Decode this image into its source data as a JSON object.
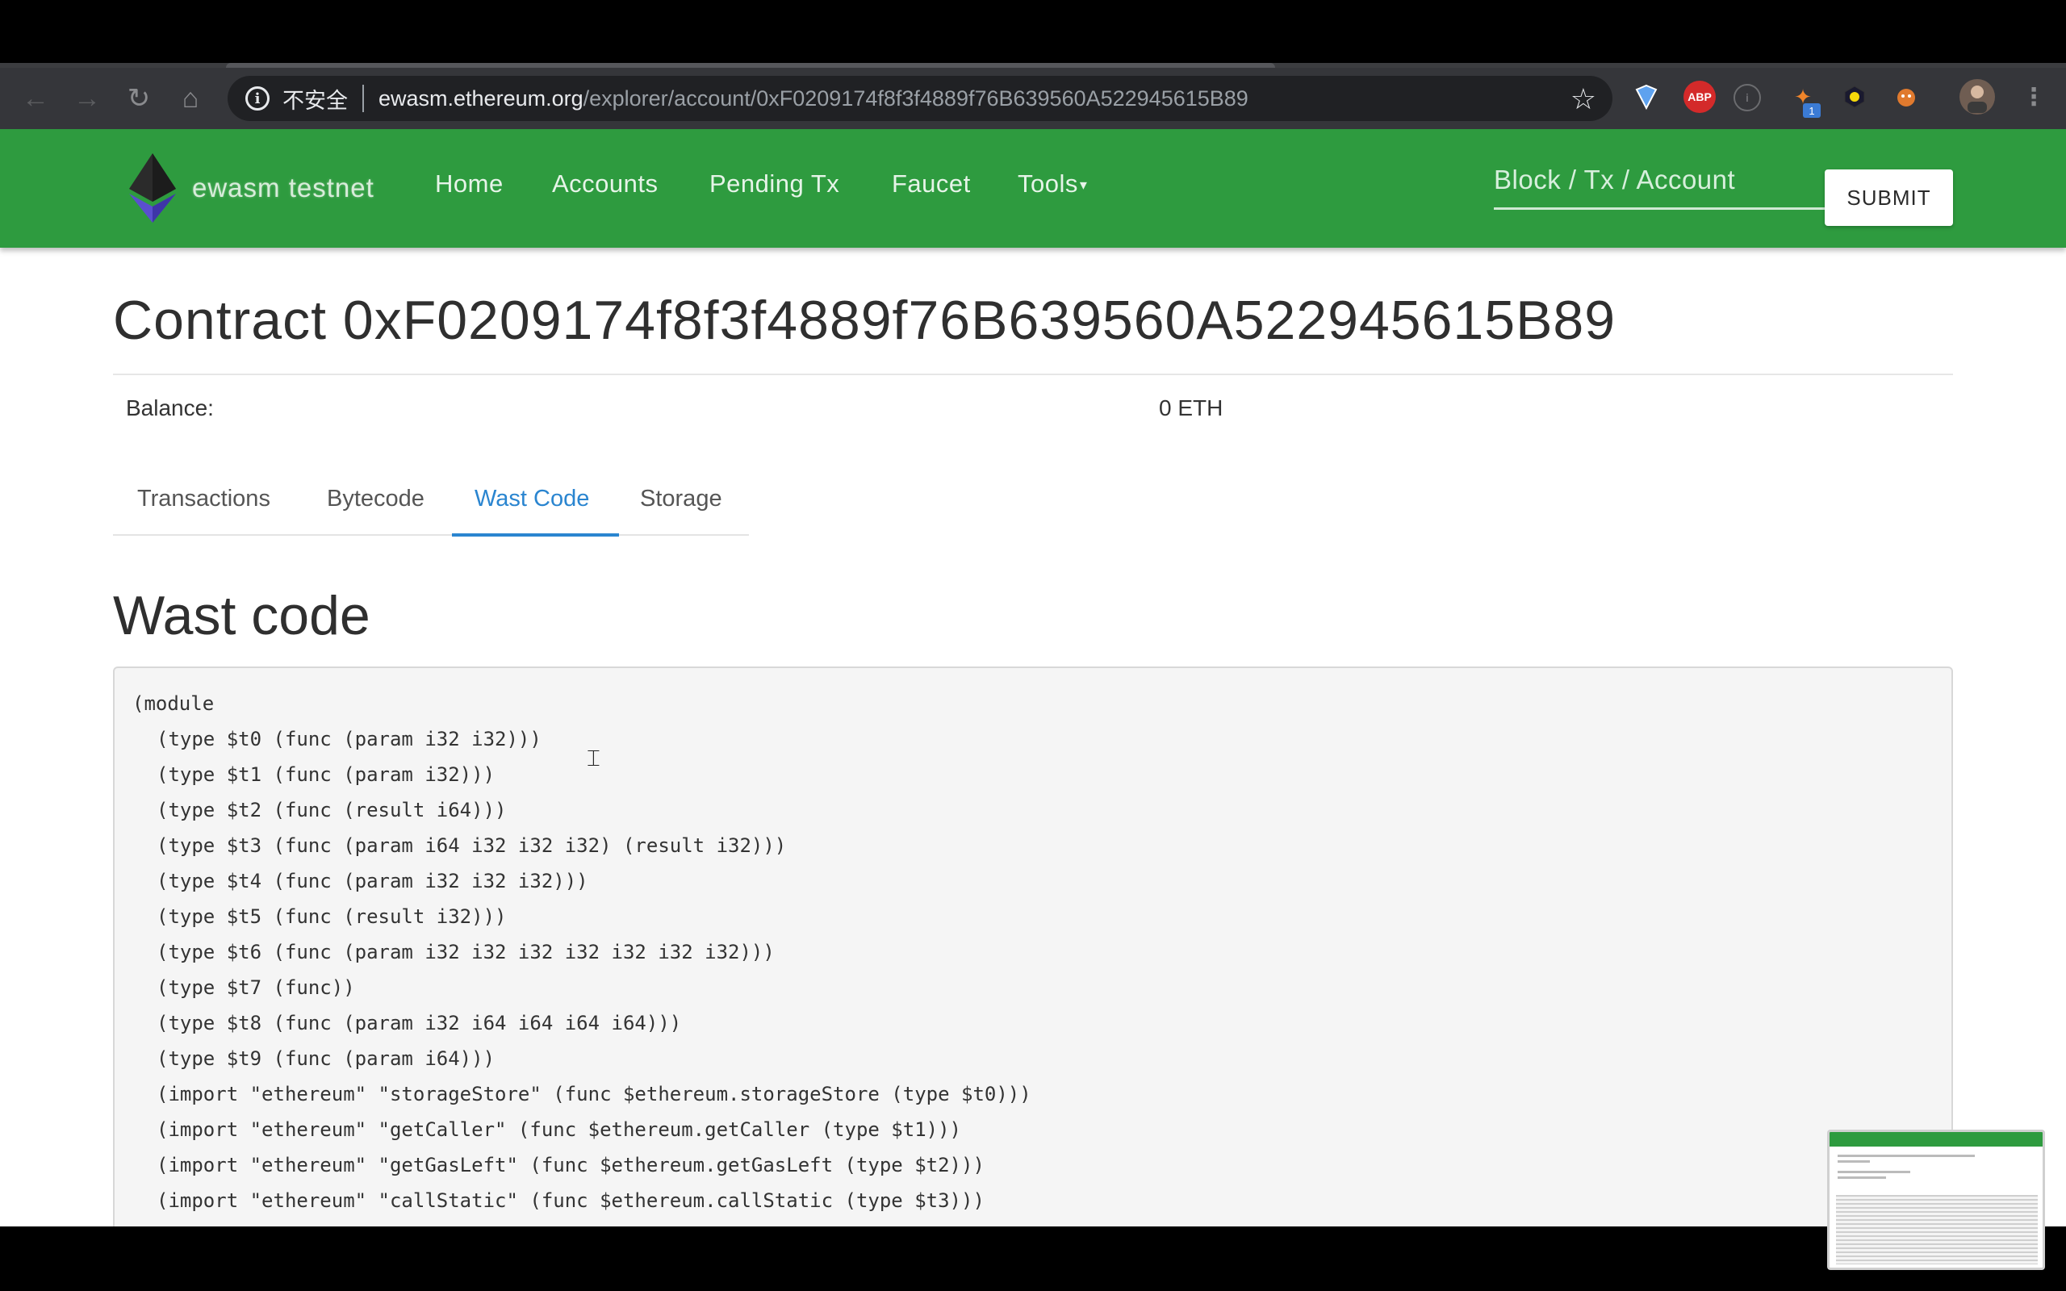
{
  "browser": {
    "security_label": "不安全",
    "url_host": "ewasm.ethereum.org",
    "url_path": "/explorer/account/0xF0209174f8f3f4889f76B639560A522945615B89",
    "extensions": [
      {
        "name": "ABP",
        "color": "#d42a2a"
      },
      {
        "name": "1",
        "color": "#3b7bd4"
      }
    ]
  },
  "site": {
    "brand": "ewasm testnet",
    "nav": [
      "Home",
      "Accounts",
      "Pending Tx",
      "Faucet",
      "Tools"
    ],
    "search_placeholder": "Block / Tx / Account",
    "submit_label": "SUBMIT"
  },
  "contract": {
    "title": "Contract 0xF0209174f8f3f4889f76B639560A522945615B89",
    "balance_label": "Balance:",
    "balance_value": "0 ETH"
  },
  "tabs": [
    "Transactions",
    "Bytecode",
    "Wast Code",
    "Storage"
  ],
  "active_tab": "Wast Code",
  "wast": {
    "heading": "Wast code",
    "lines": [
      "(module",
      "(type $t0 (func (param i32 i32)))",
      "(type $t1 (func (param i32)))",
      "(type $t2 (func (result i64)))",
      "(type $t3 (func (param i64 i32 i32 i32) (result i32)))",
      "(type $t4 (func (param i32 i32 i32)))",
      "(type $t5 (func (result i32)))",
      "(type $t6 (func (param i32 i32 i32 i32 i32 i32 i32)))",
      "(type $t7 (func))",
      "(type $t8 (func (param i32 i64 i64 i64 i64)))",
      "(type $t9 (func (param i64)))",
      "(import \"ethereum\" \"storageStore\" (func $ethereum.storageStore (type $t0)))",
      "(import \"ethereum\" \"getCaller\" (func $ethereum.getCaller (type $t1)))",
      "(import \"ethereum\" \"getGasLeft\" (func $ethereum.getGasLeft (type $t2)))",
      "(import \"ethereum\" \"callStatic\" (func $ethereum.callStatic (type $t3)))"
    ]
  },
  "colors": {
    "navbar": "#2e9b3f",
    "active_tab": "#2a85d0",
    "code_bg": "#f5f5f5"
  }
}
